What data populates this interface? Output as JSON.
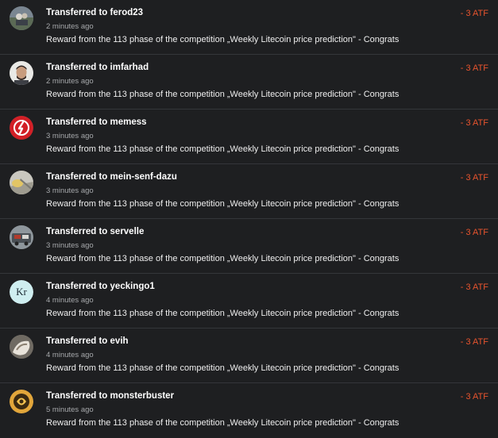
{
  "transfers": [
    {
      "title": "Transferred to ferod23",
      "time": "2 minutes ago",
      "memo": "Reward from the 113 phase of the competition „Weekly Litecoin price prediction\" - Congrats",
      "amount": "- 3 ATF",
      "avatar": "avatar-ferod23"
    },
    {
      "title": "Transferred to imfarhad",
      "time": "2 minutes ago",
      "memo": "Reward from the 113 phase of the competition „Weekly Litecoin price prediction\" - Congrats",
      "amount": "- 3 ATF",
      "avatar": "avatar-imfarhad"
    },
    {
      "title": "Transferred to memess",
      "time": "3 minutes ago",
      "memo": "Reward from the 113 phase of the competition „Weekly Litecoin price prediction\" - Congrats",
      "amount": "- 3 ATF",
      "avatar": "avatar-memess"
    },
    {
      "title": "Transferred to mein-senf-dazu",
      "time": "3 minutes ago",
      "memo": "Reward from the 113 phase of the competition „Weekly Litecoin price prediction\" - Congrats",
      "amount": "- 3 ATF",
      "avatar": "avatar-mein-senf-dazu"
    },
    {
      "title": "Transferred to servelle",
      "time": "3 minutes ago",
      "memo": "Reward from the 113 phase of the competition „Weekly Litecoin price prediction\" - Congrats",
      "amount": "- 3 ATF",
      "avatar": "avatar-servelle"
    },
    {
      "title": "Transferred to yeckingo1",
      "time": "4 minutes ago",
      "memo": "Reward from the 113 phase of the competition „Weekly Litecoin price prediction\" - Congrats",
      "amount": "- 3 ATF",
      "avatar": "avatar-yeckingo1",
      "avatar_text": "Kr"
    },
    {
      "title": "Transferred to evih",
      "time": "4 minutes ago",
      "memo": "Reward from the 113 phase of the competition „Weekly Litecoin price prediction\" - Congrats",
      "amount": "- 3 ATF",
      "avatar": "avatar-evih"
    },
    {
      "title": "Transferred to monsterbuster",
      "time": "5 minutes ago",
      "memo": "Reward from the 113 phase of the competition „Weekly Litecoin price prediction\" - Congrats",
      "amount": "- 3 ATF",
      "avatar": "avatar-monsterbuster"
    }
  ],
  "colors": {
    "background": "#1e1f21",
    "divider": "#34363a",
    "amount": "#e8542e",
    "muted": "#a6a8ab"
  }
}
